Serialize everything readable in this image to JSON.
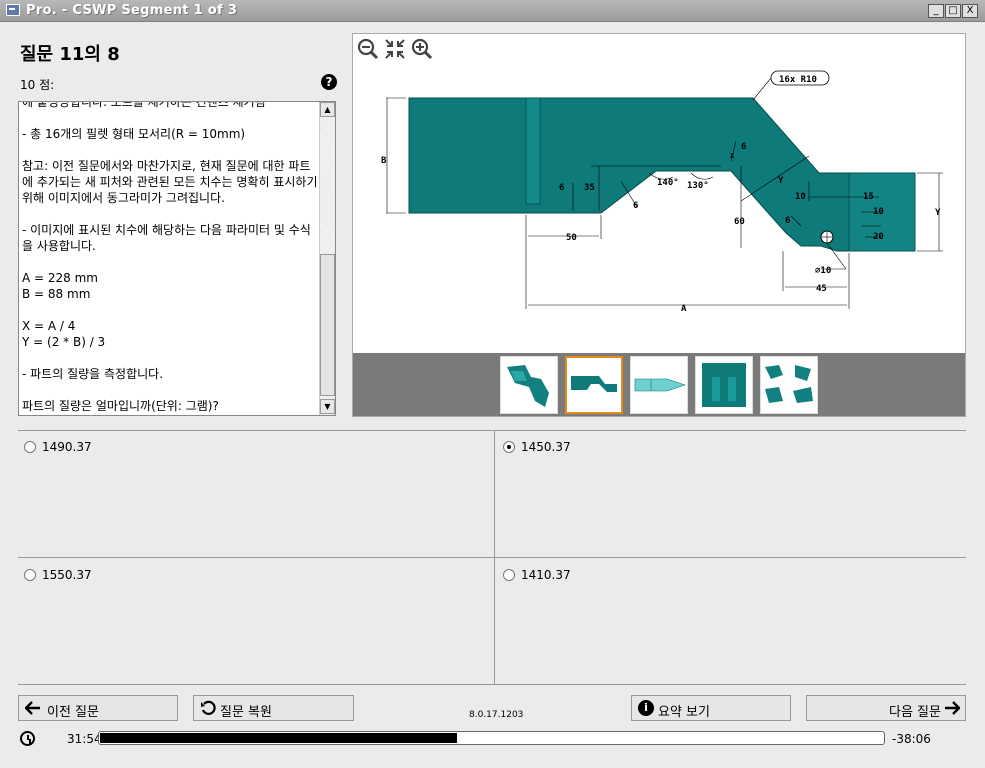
{
  "window": {
    "title": "Pro. - CSWP Segment 1 of 3",
    "minimize": "_",
    "maximize": "□",
    "close": "X"
  },
  "question": {
    "title": "질문 11의 8",
    "points": "10 점:",
    "help_icon": "question-circle-icon",
    "text": "에 붙정랑합니다. 노르를 제거하는 컨텐츠 제거됨\n\n- 총 16개의 필렛 형태 모서리(R = 10mm)\n\n참고: 이전 질문에서와 마찬가지로, 현재 질문에 대한 파트에 추가되는 새 피처와 관련된 모든 치수는 명확히 표시하기 위해 이미지에서 동그라미가 그려집니다.\n\n- 이미지에 표시된 치수에 해당하는 다음 파라미터 및 수식을 사용합니다.\n\nA = 228 mm\nB = 88 mm\n\nX = A / 4\nY = (2 * B) / 3\n\n- 파트의 질량을 측정합니다.\n\n파트의 질량은 얼마입니까(단위: 그램)?"
  },
  "drawing": {
    "fillet_note": "16x R10",
    "dims": {
      "b": "B",
      "y_left": "Y",
      "y_right": "Y",
      "x": "X",
      "a": "A",
      "d6a": "6",
      "d35": "35",
      "d6b": "6",
      "d140": "140°",
      "d130": "130°",
      "d6c": "6",
      "d6d": "6",
      "d60": "60",
      "d50": "50",
      "d10a": "10",
      "d15": "15",
      "d10b": "10",
      "d20": "20",
      "d6e": "6",
      "d45": "45",
      "dia10": "∅10"
    },
    "zoom_out_icon": "zoom-out-icon",
    "fit_icon": "fit-screen-icon",
    "zoom_in_icon": "zoom-in-icon"
  },
  "thumbnails": [
    {
      "name": "thumb-3d-view",
      "selected": false
    },
    {
      "name": "thumb-front-view",
      "selected": true
    },
    {
      "name": "thumb-top-view",
      "selected": false
    },
    {
      "name": "thumb-iso-view",
      "selected": false
    },
    {
      "name": "thumb-parts-view",
      "selected": false
    }
  ],
  "answers": [
    {
      "label": "1490.37",
      "checked": false
    },
    {
      "label": "1450.37",
      "checked": true
    },
    {
      "label": "1550.37",
      "checked": false
    },
    {
      "label": "1410.37",
      "checked": false
    }
  ],
  "footer": {
    "prev_label": "이전 질문",
    "reset_label": "질문 복원",
    "version": "8.0.17.1203",
    "summary_label": "요약 보기",
    "next_label": "다음 질문",
    "elapsed": "31:54",
    "remaining": "-38:06",
    "progress": 0.456
  },
  "colors": {
    "part_fill": "#0f7a7a",
    "selected_thumb": "#e68a1a",
    "titlebar": "#a8a8a8"
  }
}
